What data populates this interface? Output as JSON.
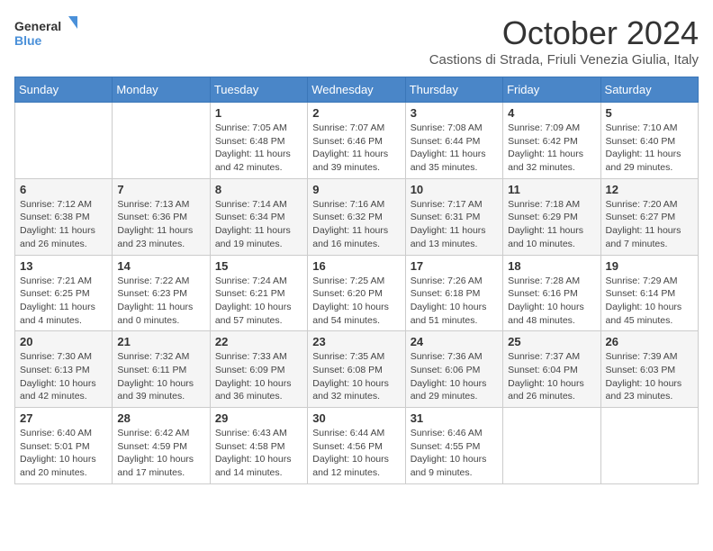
{
  "header": {
    "logo_line1": "General",
    "logo_line2": "Blue",
    "month_title": "October 2024",
    "subtitle": "Castions di Strada, Friuli Venezia Giulia, Italy"
  },
  "days_of_week": [
    "Sunday",
    "Monday",
    "Tuesday",
    "Wednesday",
    "Thursday",
    "Friday",
    "Saturday"
  ],
  "weeks": [
    [
      {
        "num": "",
        "info": ""
      },
      {
        "num": "",
        "info": ""
      },
      {
        "num": "1",
        "info": "Sunrise: 7:05 AM\nSunset: 6:48 PM\nDaylight: 11 hours and 42 minutes."
      },
      {
        "num": "2",
        "info": "Sunrise: 7:07 AM\nSunset: 6:46 PM\nDaylight: 11 hours and 39 minutes."
      },
      {
        "num": "3",
        "info": "Sunrise: 7:08 AM\nSunset: 6:44 PM\nDaylight: 11 hours and 35 minutes."
      },
      {
        "num": "4",
        "info": "Sunrise: 7:09 AM\nSunset: 6:42 PM\nDaylight: 11 hours and 32 minutes."
      },
      {
        "num": "5",
        "info": "Sunrise: 7:10 AM\nSunset: 6:40 PM\nDaylight: 11 hours and 29 minutes."
      }
    ],
    [
      {
        "num": "6",
        "info": "Sunrise: 7:12 AM\nSunset: 6:38 PM\nDaylight: 11 hours and 26 minutes."
      },
      {
        "num": "7",
        "info": "Sunrise: 7:13 AM\nSunset: 6:36 PM\nDaylight: 11 hours and 23 minutes."
      },
      {
        "num": "8",
        "info": "Sunrise: 7:14 AM\nSunset: 6:34 PM\nDaylight: 11 hours and 19 minutes."
      },
      {
        "num": "9",
        "info": "Sunrise: 7:16 AM\nSunset: 6:32 PM\nDaylight: 11 hours and 16 minutes."
      },
      {
        "num": "10",
        "info": "Sunrise: 7:17 AM\nSunset: 6:31 PM\nDaylight: 11 hours and 13 minutes."
      },
      {
        "num": "11",
        "info": "Sunrise: 7:18 AM\nSunset: 6:29 PM\nDaylight: 11 hours and 10 minutes."
      },
      {
        "num": "12",
        "info": "Sunrise: 7:20 AM\nSunset: 6:27 PM\nDaylight: 11 hours and 7 minutes."
      }
    ],
    [
      {
        "num": "13",
        "info": "Sunrise: 7:21 AM\nSunset: 6:25 PM\nDaylight: 11 hours and 4 minutes."
      },
      {
        "num": "14",
        "info": "Sunrise: 7:22 AM\nSunset: 6:23 PM\nDaylight: 11 hours and 0 minutes."
      },
      {
        "num": "15",
        "info": "Sunrise: 7:24 AM\nSunset: 6:21 PM\nDaylight: 10 hours and 57 minutes."
      },
      {
        "num": "16",
        "info": "Sunrise: 7:25 AM\nSunset: 6:20 PM\nDaylight: 10 hours and 54 minutes."
      },
      {
        "num": "17",
        "info": "Sunrise: 7:26 AM\nSunset: 6:18 PM\nDaylight: 10 hours and 51 minutes."
      },
      {
        "num": "18",
        "info": "Sunrise: 7:28 AM\nSunset: 6:16 PM\nDaylight: 10 hours and 48 minutes."
      },
      {
        "num": "19",
        "info": "Sunrise: 7:29 AM\nSunset: 6:14 PM\nDaylight: 10 hours and 45 minutes."
      }
    ],
    [
      {
        "num": "20",
        "info": "Sunrise: 7:30 AM\nSunset: 6:13 PM\nDaylight: 10 hours and 42 minutes."
      },
      {
        "num": "21",
        "info": "Sunrise: 7:32 AM\nSunset: 6:11 PM\nDaylight: 10 hours and 39 minutes."
      },
      {
        "num": "22",
        "info": "Sunrise: 7:33 AM\nSunset: 6:09 PM\nDaylight: 10 hours and 36 minutes."
      },
      {
        "num": "23",
        "info": "Sunrise: 7:35 AM\nSunset: 6:08 PM\nDaylight: 10 hours and 32 minutes."
      },
      {
        "num": "24",
        "info": "Sunrise: 7:36 AM\nSunset: 6:06 PM\nDaylight: 10 hours and 29 minutes."
      },
      {
        "num": "25",
        "info": "Sunrise: 7:37 AM\nSunset: 6:04 PM\nDaylight: 10 hours and 26 minutes."
      },
      {
        "num": "26",
        "info": "Sunrise: 7:39 AM\nSunset: 6:03 PM\nDaylight: 10 hours and 23 minutes."
      }
    ],
    [
      {
        "num": "27",
        "info": "Sunrise: 6:40 AM\nSunset: 5:01 PM\nDaylight: 10 hours and 20 minutes."
      },
      {
        "num": "28",
        "info": "Sunrise: 6:42 AM\nSunset: 4:59 PM\nDaylight: 10 hours and 17 minutes."
      },
      {
        "num": "29",
        "info": "Sunrise: 6:43 AM\nSunset: 4:58 PM\nDaylight: 10 hours and 14 minutes."
      },
      {
        "num": "30",
        "info": "Sunrise: 6:44 AM\nSunset: 4:56 PM\nDaylight: 10 hours and 12 minutes."
      },
      {
        "num": "31",
        "info": "Sunrise: 6:46 AM\nSunset: 4:55 PM\nDaylight: 10 hours and 9 minutes."
      },
      {
        "num": "",
        "info": ""
      },
      {
        "num": "",
        "info": ""
      }
    ]
  ]
}
